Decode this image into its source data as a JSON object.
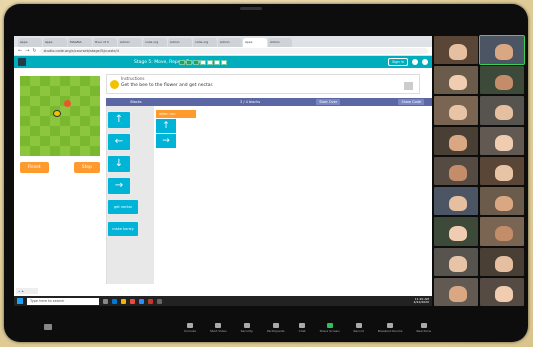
{
  "browser": {
    "tabs": [
      "Apps",
      "Apps",
      "MAGMA",
      "Hour of C",
      "Admin",
      "code.org",
      "Admin",
      "code.org",
      "Admin",
      "Apps",
      "Admin"
    ],
    "active_tab_index": 9,
    "url": "studio.code.org/s/courseb/stage/5/puzzle/4"
  },
  "app": {
    "puzzle_title": "Stage 5: Move, Repeat/Repeat",
    "progress": {
      "completed": 3,
      "total": 7
    },
    "sign_in_label": "Sign in"
  },
  "game": {
    "reset_label": "Reset",
    "step_label": "Step"
  },
  "instructions": {
    "title": "Instructions",
    "text": "Get the bee to the flower and get nectar."
  },
  "workspace": {
    "toolbox_label": "Blocks",
    "count_text": "3 / 4 blocks",
    "start_over_label": "Start Over",
    "show_code_label": "Show Code",
    "when_run_label": "when run",
    "toolbox_blocks": [
      "up-arrow",
      "left-arrow",
      "down-arrow",
      "right-arrow",
      "get-nectar",
      "make-honey"
    ],
    "toolbox_labels": {
      "nectar": "get nectar",
      "honey": "make honey"
    },
    "program_blocks": [
      "up-arrow",
      "right-arrow"
    ]
  },
  "taskbar": {
    "search_placeholder": "Type here to search",
    "time": "11:20 AM",
    "date": "4/22/2020"
  },
  "zoom": {
    "controls": [
      "Unmute",
      "Start Video",
      "Security",
      "Participants",
      "Chat",
      "Share Screen",
      "Record",
      "Breakout Rooms",
      "Reactions"
    ]
  },
  "colors": {
    "header_teal": "#00adbc",
    "block_cyan": "#00b4d8",
    "start_orange": "#ff9a2e",
    "toolbar_purple": "#5b67a5",
    "maze_green": "#8cc63f"
  }
}
